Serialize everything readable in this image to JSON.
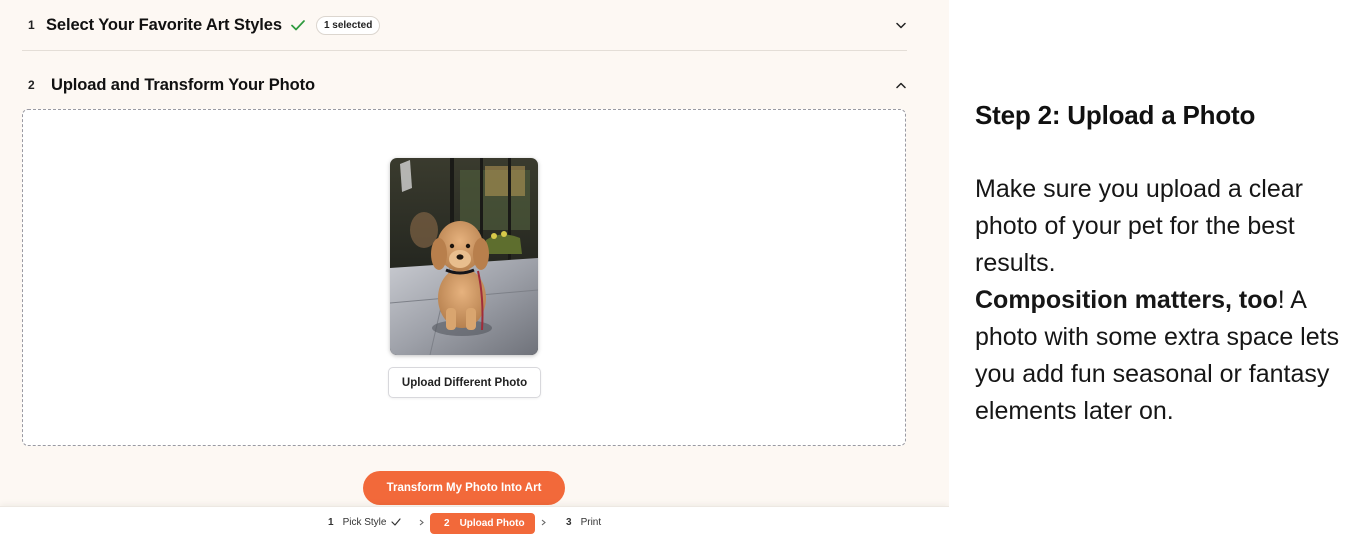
{
  "step1": {
    "number": "1",
    "title": "Select Your Favorite Art Styles",
    "badge": "1 selected"
  },
  "step2": {
    "number": "2",
    "title": "Upload and Transform Your Photo",
    "upload_button": "Upload Different Photo"
  },
  "transform_button": "Transform My Photo Into Art",
  "progress": {
    "items": [
      {
        "number": "1",
        "label": "Pick Style"
      },
      {
        "number": "2",
        "label": "Upload Photo"
      },
      {
        "number": "3",
        "label": "Print"
      }
    ]
  },
  "sidebar": {
    "title": "Step 2: Upload a Photo",
    "paragraph1": "Make sure you upload a clear photo of your pet for the best results.",
    "emphasis": "Composition matters, too",
    "paragraph2": "! A photo with some extra space lets you add fun seasonal or fantasy elements later on."
  },
  "colors": {
    "accent": "#f2693a",
    "background": "#fdf8f3",
    "check": "#2e9a3e"
  },
  "icons": {
    "check": "check-icon",
    "collapse": "chevron-down-icon",
    "expand": "chevron-up-icon",
    "separator": "chevron-right-icon"
  }
}
